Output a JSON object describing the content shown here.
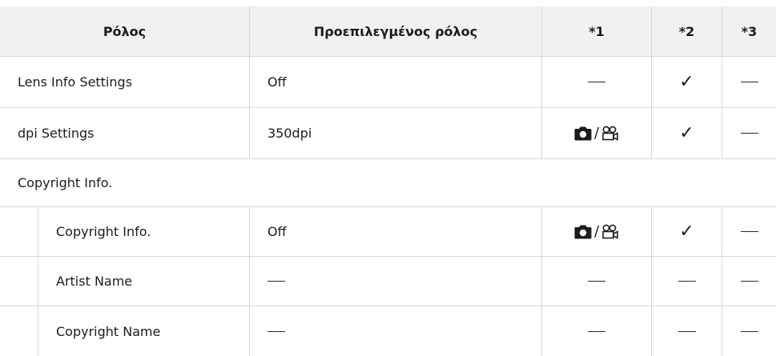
{
  "headers": {
    "role": "Ρόλος",
    "default": "Προεπιλεγμένος ρόλος",
    "s1": "*1",
    "s2": "*2",
    "s3": "*3"
  },
  "rows": [
    {
      "role": "Lens Info Settings",
      "default": "Off",
      "s1": "dash",
      "s2": "check",
      "s3": "dash"
    },
    {
      "role": "dpi Settings",
      "default": "350dpi",
      "s1": "camera-movie",
      "s2": "check",
      "s3": "dash"
    }
  ],
  "section": {
    "label": "Copyright Info."
  },
  "subrows": [
    {
      "role": "Copyright Info.",
      "default": "Off",
      "s1": "camera-movie",
      "s2": "check",
      "s3": "dash"
    },
    {
      "role": "Artist Name",
      "default": "dash",
      "s1": "dash",
      "s2": "dash",
      "s3": "dash"
    },
    {
      "role": "Copyright Name",
      "default": "dash",
      "s1": "dash",
      "s2": "dash",
      "s3": "dash"
    }
  ],
  "symbols": {
    "slash": "/",
    "check": "✓"
  }
}
